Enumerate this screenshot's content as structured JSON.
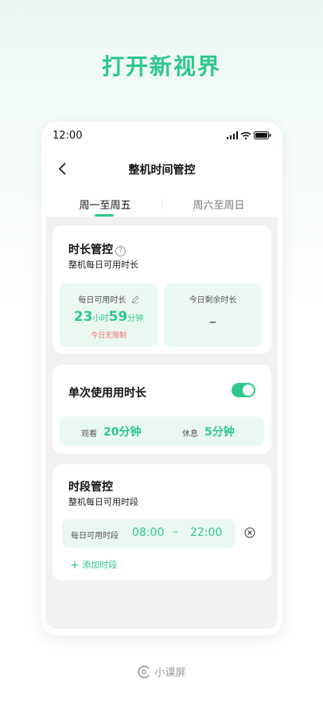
{
  "headline": "打开新视界",
  "status": {
    "time": "12:00"
  },
  "nav": {
    "title": "整机时间管控"
  },
  "tabs": [
    {
      "label": "周一至周五"
    },
    {
      "label": "周六至周日"
    }
  ],
  "duration_card": {
    "title": "时长管控",
    "subtitle": "整机每日可用时长",
    "daily_available": {
      "label": "每日可用时长",
      "hours": "23",
      "hours_unit": "小时",
      "minutes": "59",
      "minutes_unit": "分钟",
      "note": "今日无限制"
    },
    "remaining": {
      "label": "今日剩余时长",
      "value": "–"
    }
  },
  "single_use_card": {
    "title": "单次使用用时长",
    "toggle_on": true,
    "watch_label": "观看",
    "watch_value": "20分钟",
    "rest_label": "休息",
    "rest_value": "5分钟"
  },
  "period_card": {
    "title": "时段管控",
    "subtitle": "整机每日可用时段",
    "row_label": "每日可用时段",
    "start": "08:00",
    "separator": "–",
    "end": "22:00",
    "add_label": "添加时段"
  },
  "footer": {
    "brand": "小课屏"
  },
  "colors": {
    "accent": "#2ec88b",
    "warn": "#f06c6c"
  }
}
